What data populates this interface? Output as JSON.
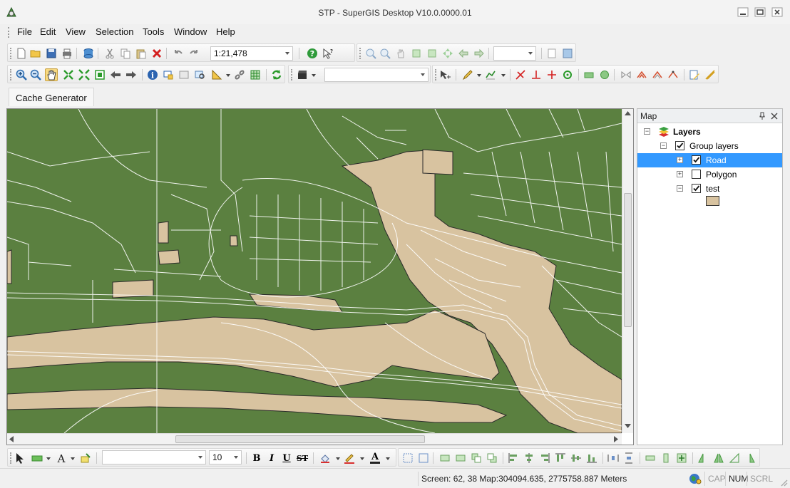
{
  "window": {
    "title": "STP - SuperGIS Desktop V10.0.0000.01"
  },
  "menu": [
    "File",
    "Edit",
    "View",
    "Selection",
    "Tools",
    "Window",
    "Help"
  ],
  "toolbar": {
    "scale_value": "1:21,478",
    "layer_combo_value": "",
    "zoom_combo_value": ""
  },
  "tabs": {
    "cache_generator": "Cache Generator"
  },
  "panel": {
    "title": "Map",
    "tree": {
      "root": "Layers",
      "group": "Group layers",
      "layers": [
        {
          "name": "Road",
          "checked": true,
          "selected": true
        },
        {
          "name": "Polygon",
          "checked": false,
          "selected": false
        },
        {
          "name": "test",
          "checked": true,
          "selected": false
        }
      ]
    }
  },
  "format_toolbar": {
    "font_name": "",
    "font_size": "10",
    "bold": "B",
    "italic": "I",
    "underline": "U",
    "strike": "ST",
    "text_color_letter": "A"
  },
  "status": {
    "coords": "Screen: 62, 38  Map:304094.635, 2775758.887 Meters",
    "caps": "CAP",
    "num": "NUM",
    "scroll": "SCRL"
  },
  "colors": {
    "land": "#5b8040",
    "polygon_fill": "#d8c3a0",
    "road": "#ffffff",
    "selection": "#3399ff"
  }
}
